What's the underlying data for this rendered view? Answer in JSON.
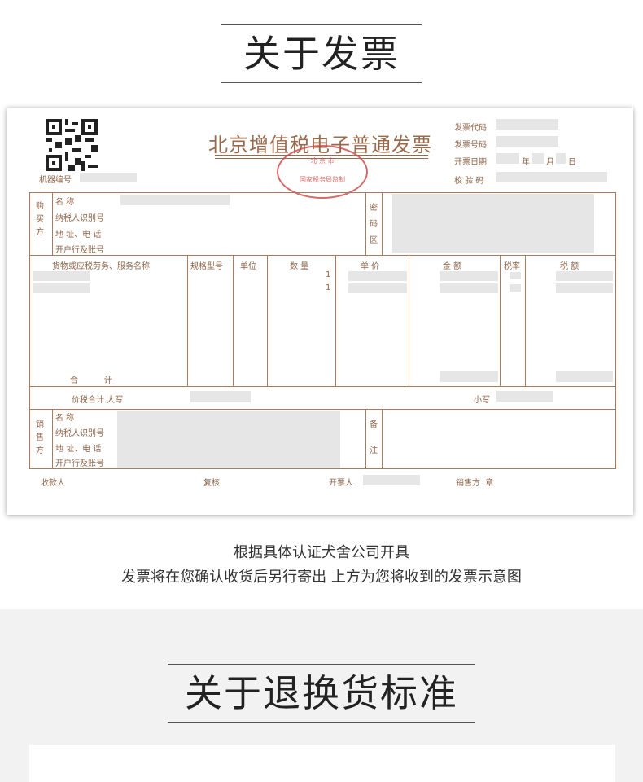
{
  "section1_title": "关于发票",
  "invoice": {
    "title": "北京增值税电子普通发票",
    "stamp_line1": "北 京 市",
    "stamp_line2": "国家税务局监制",
    "machine_no_label": "机器编号",
    "code_label": "发票代码",
    "number_label": "发票号码",
    "date_label": "开票日期",
    "year_label": "年",
    "month_label": "月",
    "day_label": "日",
    "check_label": "校 验 码",
    "buyer_side": "购\n买\n方",
    "buyer_name": "名    称",
    "buyer_tax_id": "纳税人识别号",
    "buyer_addr": "地 址、电 话",
    "buyer_bank": "开户行及账号",
    "cipher_side": "密\n码\n区",
    "col_goods": "货物或应税劳务、服务名称",
    "col_spec": "规格型号",
    "col_unit": "单位",
    "col_qty": "数 量",
    "col_price": "单 价",
    "col_amount": "金 额",
    "col_rate": "税率",
    "col_tax": "税 额",
    "qty_row1": "1",
    "qty_row2": "1",
    "total_label": "合          计",
    "total_words_label": "价税合计 大写",
    "small_label": "小写",
    "seller_side": "销\n售\n方",
    "seller_name": "名    称",
    "seller_tax_id": "纳税人识别号",
    "seller_addr": "地 址、电 话",
    "seller_bank": "开户行及账号",
    "remark_side": "备\n\n注",
    "payee_label": "收款人",
    "reviewer_label": "复核",
    "drawer_label": "开票人",
    "seller_seal_label": "销售方  章"
  },
  "caption_line1": "根据具体认证犬舍公司开具",
  "caption_line2": "发票将在您确认收货后另行寄出 上方为您将收到的发票示意图",
  "section2_title": "关于退换货标准",
  "colors": {
    "invoice_brown": "#9a6a4d",
    "stamp_red": "#cc4444",
    "grey_bg": "#f2f2f2"
  }
}
